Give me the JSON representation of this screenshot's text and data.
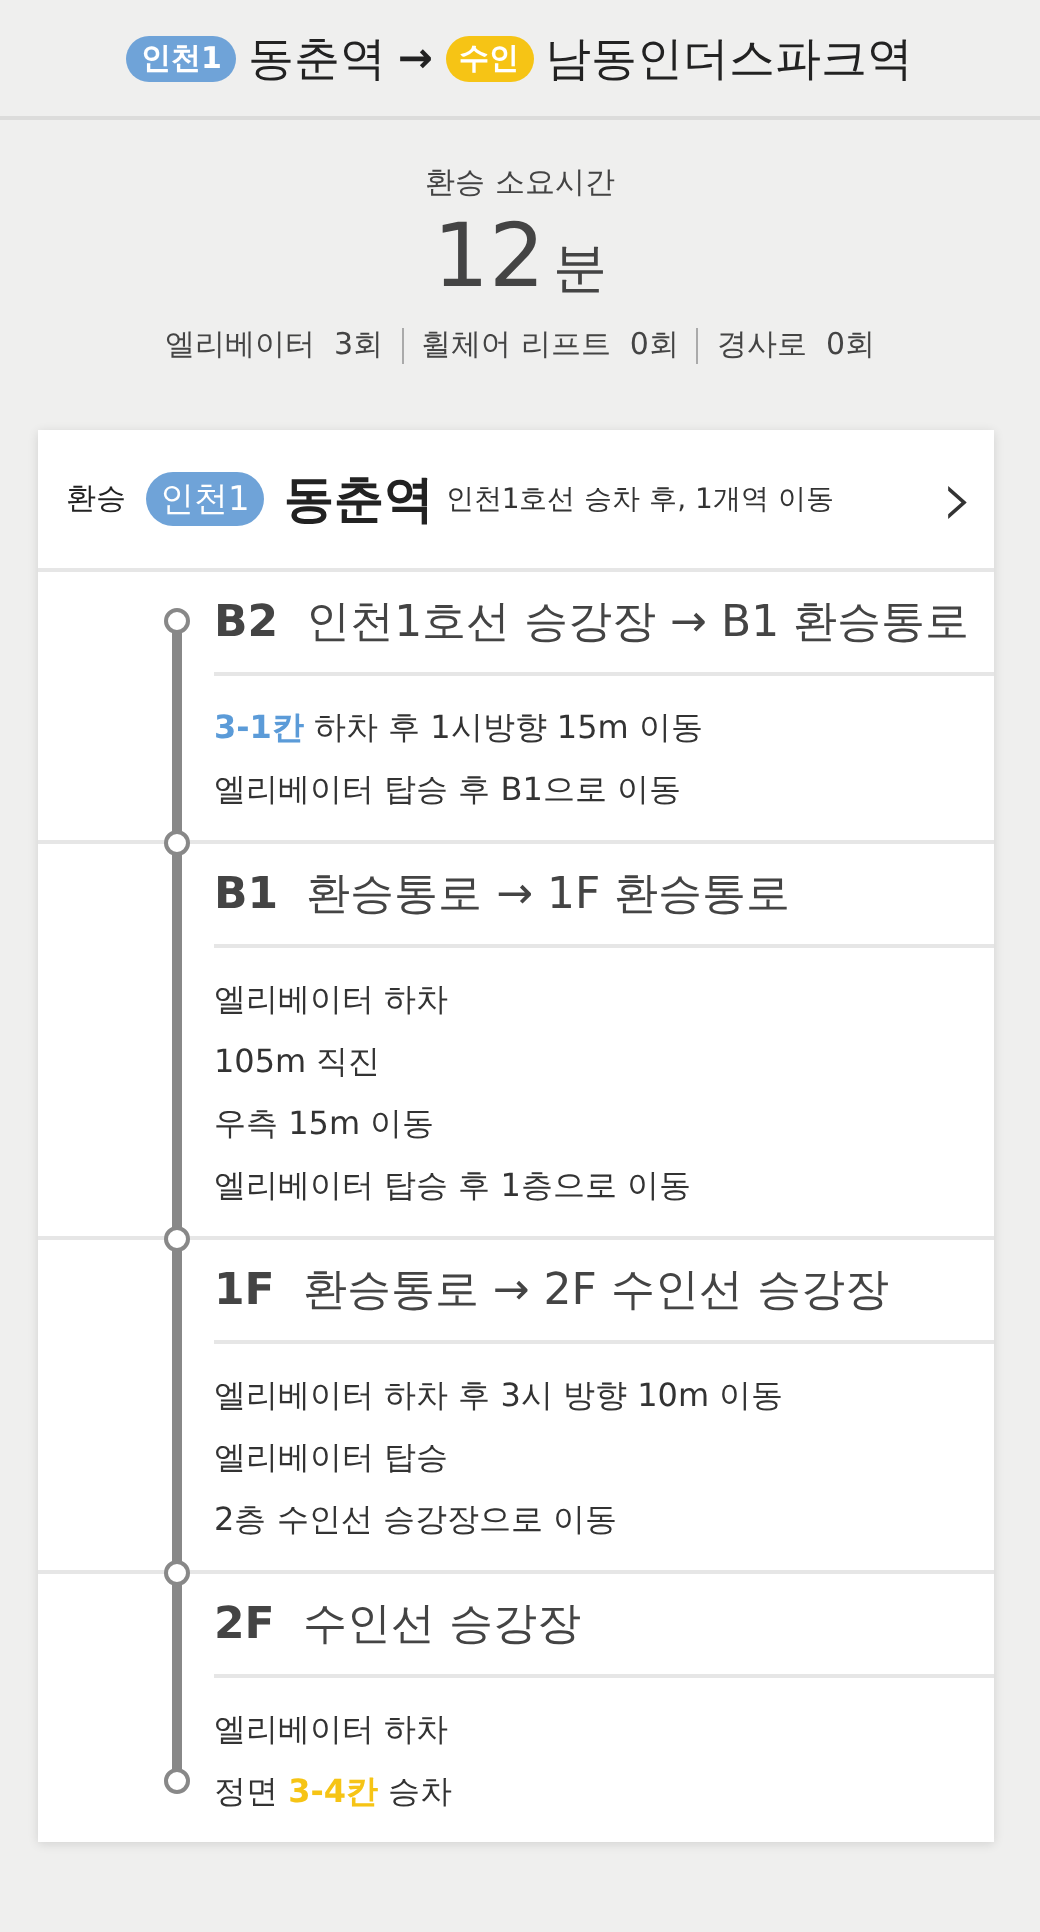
{
  "route": {
    "from": {
      "line": "인천1",
      "color": "#6fa3d8",
      "station": "동춘역"
    },
    "arrow": "→",
    "to": {
      "line": "수인",
      "color": "#f6c415",
      "station": "남동인더스파크역"
    }
  },
  "summary": {
    "label": "환승 소요시간",
    "time": "12",
    "unit": "분",
    "facilities": [
      {
        "name": "엘리베이터",
        "count": "3회"
      },
      {
        "name": "휠체어 리프트",
        "count": "0회"
      },
      {
        "name": "경사로",
        "count": "0회"
      }
    ]
  },
  "transfer": {
    "label": "환승",
    "line": "인천1",
    "color": "#6fa3d8",
    "station": "동춘역",
    "note": "인천1호선 승차 후, 1개역 이동",
    "chevron": "›"
  },
  "sections": [
    {
      "floor": "B2",
      "route": "인천1호선 승강장 → B1 환승통로",
      "steps": [
        [
          {
            "text": "3-1칸",
            "color": "#5b9bd8"
          },
          {
            "text": " 하차 후 1시방향 15m 이동"
          }
        ],
        [
          {
            "text": "엘리베이터 탑승 후 B1으로 이동"
          }
        ]
      ]
    },
    {
      "floor": "B1",
      "route": "환승통로 → 1F 환승통로",
      "steps": [
        [
          {
            "text": "엘리베이터 하차"
          }
        ],
        [
          {
            "text": "105m 직진"
          }
        ],
        [
          {
            "text": "우측 15m 이동"
          }
        ],
        [
          {
            "text": "엘리베이터 탑승 후 1층으로 이동"
          }
        ]
      ]
    },
    {
      "floor": "1F",
      "route": "환승통로 → 2F 수인선 승강장",
      "steps": [
        [
          {
            "text": "엘리베이터 하차 후 3시 방향 10m 이동"
          }
        ],
        [
          {
            "text": "엘리베이터 탑승"
          }
        ],
        [
          {
            "text": "2층 수인선 승강장으로 이동"
          }
        ]
      ]
    },
    {
      "floor": "2F",
      "route": "수인선 승강장",
      "steps": [
        [
          {
            "text": "엘리베이터 하차"
          }
        ],
        [
          {
            "text": "정면 "
          },
          {
            "text": "3-4칸",
            "color": "#f6c415"
          },
          {
            "text": " 승차"
          }
        ]
      ]
    }
  ]
}
